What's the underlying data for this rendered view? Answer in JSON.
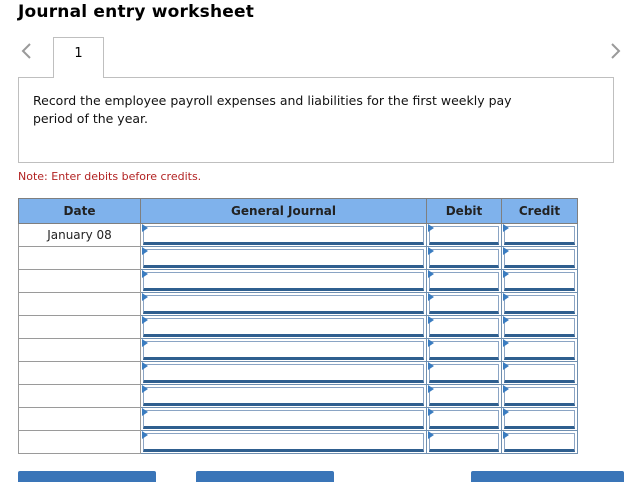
{
  "title": "Journal entry worksheet",
  "tab": {
    "label": "1"
  },
  "nav": {
    "prev_icon": "chevron-left-icon",
    "next_icon": "chevron-right-icon"
  },
  "prompt": "Record the employee payroll expenses and liabilities for the first weekly pay period of the year.",
  "note": "Note: Enter debits before credits.",
  "journal": {
    "headers": {
      "date": "Date",
      "general_journal": "General Journal",
      "debit": "Debit",
      "credit": "Credit"
    },
    "rows": [
      {
        "date": "January 08",
        "account": "",
        "debit": "",
        "credit": ""
      },
      {
        "date": "",
        "account": "",
        "debit": "",
        "credit": ""
      },
      {
        "date": "",
        "account": "",
        "debit": "",
        "credit": ""
      },
      {
        "date": "",
        "account": "",
        "debit": "",
        "credit": ""
      },
      {
        "date": "",
        "account": "",
        "debit": "",
        "credit": ""
      },
      {
        "date": "",
        "account": "",
        "debit": "",
        "credit": ""
      },
      {
        "date": "",
        "account": "",
        "debit": "",
        "credit": ""
      },
      {
        "date": "",
        "account": "",
        "debit": "",
        "credit": ""
      },
      {
        "date": "",
        "account": "",
        "debit": "",
        "credit": ""
      },
      {
        "date": "",
        "account": "",
        "debit": "",
        "credit": ""
      }
    ]
  },
  "colors": {
    "header_bg": "#7fb2ec",
    "note": "#b22222",
    "button": "#3a75b8",
    "input_border": "#2f5f8f"
  }
}
